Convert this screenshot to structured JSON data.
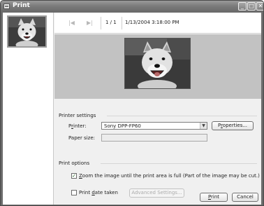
{
  "window": {
    "title": "Print",
    "minimize_glyph": "_",
    "maximize_glyph": "□",
    "close_glyph": "✕"
  },
  "navigation": {
    "first_glyph": "|◀",
    "next_glyph": "▶|",
    "page_indicator": "1 / 1",
    "date_time": "1/13/2004 3:18:00 PM"
  },
  "printer_settings": {
    "section_title": "Printer settings",
    "printer_label_mnemonic": "r",
    "printer_label_rest": "inter:",
    "printer_label_first": "P",
    "printer_value": "Sony DPP-FP60",
    "properties_mnemonic": "r",
    "properties_before": "P",
    "properties_after": "operties...",
    "paper_size_label": "Paper size:"
  },
  "print_options": {
    "section_title": "Print options",
    "zoom_checked": true,
    "zoom_mnemonic": "Z",
    "zoom_label_rest": "oom the image until the print area is full (Part of the image may be cut.)",
    "print_date_checked": false,
    "print_date_before": "Print ",
    "print_date_mnemonic": "d",
    "print_date_after": "ate taken",
    "advanced_settings_label": "Advanced Settings..."
  },
  "actions": {
    "print_mnemonic": "P",
    "print_rest": "rint",
    "cancel_label": "Cancel"
  },
  "icons": {
    "app": "printer-window-icon",
    "first": "first-page-icon",
    "next": "next-page-icon",
    "dropdown": "chevron-down-icon",
    "check": "checkmark-icon"
  }
}
